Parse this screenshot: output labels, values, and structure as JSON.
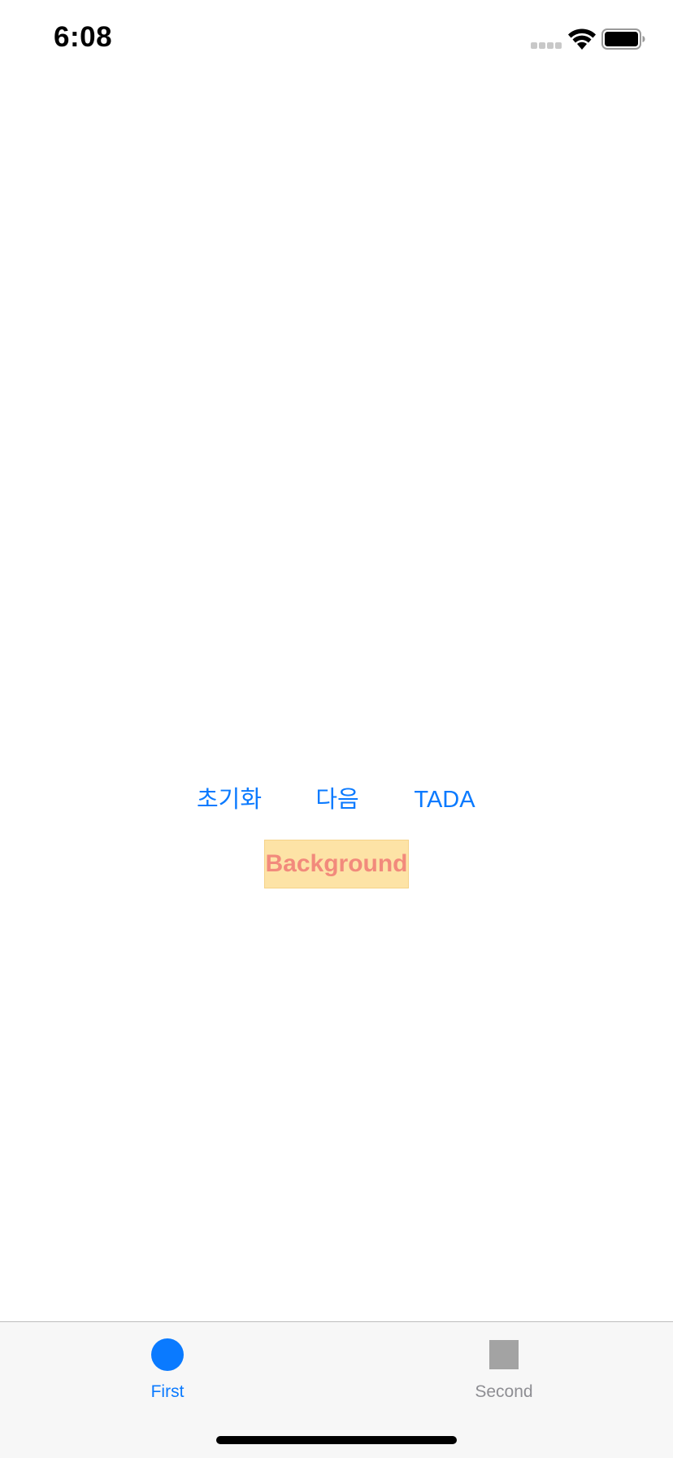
{
  "status_bar": {
    "time": "6:08"
  },
  "buttons": {
    "reset_label": "초기화",
    "next_label": "다음",
    "tada_label": "TADA"
  },
  "background_label": {
    "text": "Background"
  },
  "tab_bar": {
    "tabs": [
      {
        "label": "First",
        "icon": "circle-icon",
        "selected": true
      },
      {
        "label": "Second",
        "icon": "square-icon",
        "selected": false
      }
    ]
  },
  "colors": {
    "accent": "#0a7aff",
    "background_label_fill": "#fde3a6",
    "background_label_text": "#f28a7c",
    "tab_inactive": "#8e8e93"
  }
}
